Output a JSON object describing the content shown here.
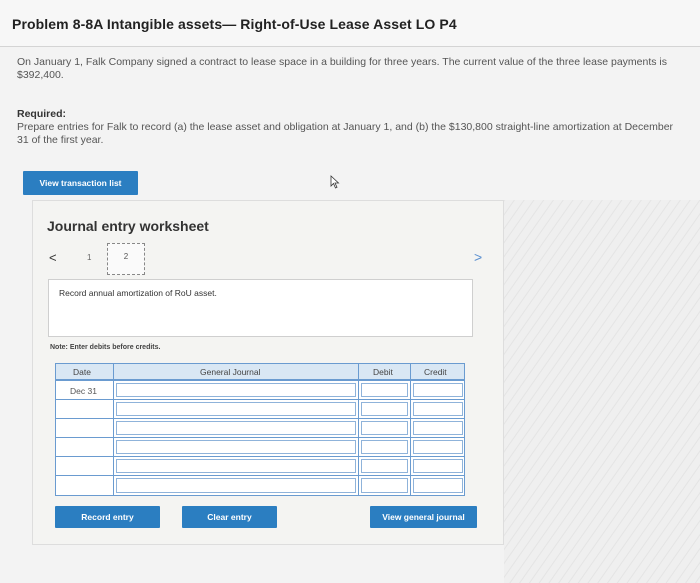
{
  "header": {
    "title": "Problem 8-8A Intangible assets— Right-of-Use Lease Asset LO P4"
  },
  "problem": {
    "text": "On January 1, Falk Company signed a contract to lease space in a building for three years. The current value of the three lease payments is $392,400.",
    "required_label": "Required:",
    "required_text": "Prepare entries for Falk to record (a) the lease asset and obligation at January 1, and (b) the $130,800 straight-line amortization at December 31 of the first year."
  },
  "buttons": {
    "view_transaction_list": "View transaction list",
    "record_entry": "Record entry",
    "clear_entry": "Clear entry",
    "view_general_journal": "View general journal"
  },
  "worksheet": {
    "title": "Journal entry worksheet",
    "pager": {
      "prev": "<",
      "page1": "1",
      "page2": "2",
      "next": ">"
    },
    "instruction": "Record annual amortization of RoU asset.",
    "note": "Note: Enter debits before credits.",
    "columns": {
      "date": "Date",
      "journal": "General Journal",
      "debit": "Debit",
      "credit": "Credit"
    },
    "rows": [
      {
        "date": "Dec 31"
      },
      {
        "date": ""
      },
      {
        "date": ""
      },
      {
        "date": ""
      },
      {
        "date": ""
      },
      {
        "date": ""
      }
    ]
  },
  "colors": {
    "button": "#2b7ec1",
    "table_border": "#6a9bd0",
    "header_bg": "#d9e7f4"
  },
  "icons": [
    "mouse-cursor-icon",
    "chevron-left-icon",
    "chevron-right-icon"
  ]
}
